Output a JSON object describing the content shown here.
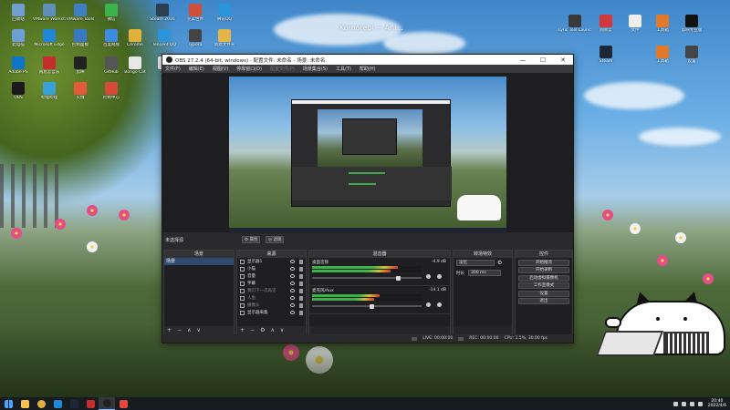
{
  "wallpaper": {
    "title": "Komorebi ~ Ani..."
  },
  "desktop_icons": [
    {
      "label": "回收站",
      "color": "#6f9fd0"
    },
    {
      "label": "VMware Workstation",
      "color": "#5d8fb9"
    },
    {
      "label": "VMware Tools",
      "color": "#3e7ec4"
    },
    {
      "label": "微信",
      "color": "#3cb44b"
    },
    {
      "label": "Steam 2016",
      "color": "#2c3e50"
    },
    {
      "label": "完美世界",
      "color": "#d04f3b"
    },
    {
      "label": "腾讯QQ",
      "color": "#2a95d9"
    },
    {
      "label": "此电脑",
      "color": "#6d9fd3"
    },
    {
      "label": "Microsoft Edge",
      "color": "#1e88d6"
    },
    {
      "label": "控制面板",
      "color": "#3a78c4"
    },
    {
      "label": "百度网盘",
      "color": "#3d8be0"
    },
    {
      "label": "Chrome",
      "color": "#e0b23c"
    },
    {
      "label": "Tencent QQ",
      "color": "#2a95d9"
    },
    {
      "label": "Typora",
      "color": "#444"
    },
    {
      "label": "新建文件夹",
      "color": "#e2b548"
    },
    {
      "label": "Adobe PS",
      "color": "#0f75c9"
    },
    {
      "label": "网易云音乐",
      "color": "#c52d2d"
    },
    {
      "label": "剪映",
      "color": "#222"
    },
    {
      "label": "GitHub",
      "color": "#555"
    },
    {
      "label": "Bongo Cat",
      "color": "#e8e8e8"
    },
    {
      "label": "文档",
      "color": "#f2f2f2"
    },
    {
      "label": "OBS",
      "color": "#1a1a1a"
    },
    {
      "label": "哔哩哔哩",
      "color": "#3aa0d8"
    },
    {
      "label": "火绒",
      "color": "#e05b3a"
    },
    {
      "label": "控制中心",
      "color": "#d64a3a"
    }
  ],
  "right_icons": [
    {
      "label": "Lyric Tool Launcher",
      "color": "#3a3a3a"
    },
    {
      "label": "网易云",
      "color": "#d13a3a"
    },
    {
      "label": "文件",
      "color": "#eee"
    },
    {
      "label": "工具箱",
      "color": "#e07a2a"
    },
    {
      "label": "剪映专业版",
      "color": "#111"
    },
    {
      "label": "Steam",
      "color": "#1b2838"
    },
    {
      "label": "工具箱",
      "color": "#e07a2a"
    },
    {
      "label": "设置",
      "color": "#444"
    }
  ],
  "window": {
    "title": "OBS 27.2.4 (64-bit, windows) - 配置文件: 未命名 - 场景: 未命名",
    "minimize": "—",
    "maximize": "☐",
    "close": "✕"
  },
  "menu": [
    "文件(F)",
    "编辑(E)",
    "视图(V)",
    "停靠窗口(D)",
    "配置文件(P)",
    "场景集合(S)",
    "工具(T)",
    "帮助(H)"
  ],
  "toolbar": {
    "no_source": "未选择源",
    "properties": "⚙ 属性",
    "filters": "◎ 滤镜"
  },
  "scenes": {
    "title": "场景",
    "items": [
      "场景"
    ]
  },
  "sources": {
    "title": "来源",
    "items": [
      {
        "name": "显示器1",
        "dim": false,
        "icon": "monitor-icon"
      },
      {
        "name": "小猫",
        "dim": false,
        "icon": "window-icon"
      },
      {
        "name": "音量",
        "dim": false,
        "icon": "audio-icon"
      },
      {
        "name": "字幕",
        "dim": false,
        "icon": "window-icon"
      },
      {
        "name": "我们下一次再见",
        "dim": true,
        "icon": "text-icon"
      },
      {
        "name": "人鱼",
        "dim": true,
        "icon": "window-icon"
      },
      {
        "name": "摄像头",
        "dim": true,
        "icon": "camera-icon"
      },
      {
        "name": "显示器采集",
        "dim": false,
        "icon": "monitor-icon"
      }
    ]
  },
  "mixer": {
    "title": "混音器",
    "channels": [
      {
        "name": "桌面音频",
        "db": "-4.9 dB",
        "level": 0.78,
        "volume": 0.8
      },
      {
        "name": "麦克风/Aux",
        "db": "-14.1 dB",
        "level": 0.62,
        "volume": 0.55
      }
    ]
  },
  "transitions": {
    "title": "转场特效",
    "type": "淡化",
    "duration_label": "时长",
    "duration": "300 ms"
  },
  "controls": {
    "title": "控件",
    "buttons": [
      "开始推流",
      "开始录制",
      "启动虚拟摄像机",
      "工作室模式",
      "设置",
      "退出"
    ]
  },
  "status": {
    "live": "LIVE: 00:00:00",
    "rec": "REC: 00:00:00",
    "cpu": "CPU: 1.5%, 30.00 fps"
  },
  "taskbar": {
    "apps": [
      {
        "name": "文件资源管理器",
        "color": "#f2c14e"
      },
      {
        "name": "Chrome",
        "color": "#e0b23c"
      },
      {
        "name": "Edge",
        "color": "#1e88d6"
      },
      {
        "name": "Steam",
        "color": "#1b2838"
      },
      {
        "name": "网易云音乐",
        "color": "#c52d2d"
      },
      {
        "name": "OBS",
        "color": "#222"
      },
      {
        "name": "QQ音乐",
        "color": "#e8463a"
      }
    ],
    "time": "20:40",
    "date": "2022/4/6"
  }
}
